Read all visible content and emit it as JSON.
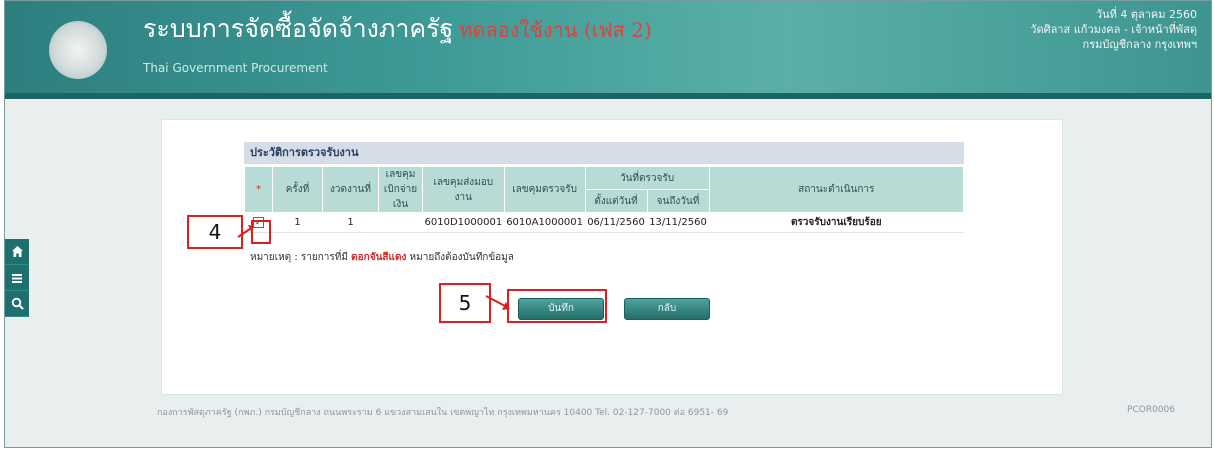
{
  "header": {
    "title": "ระบบการจัดซื้อจัดจ้างภาครัฐ",
    "title_highlight": "ทดลองใช้งาน (เฟส 2)",
    "subtitle": "Thai Government Procurement",
    "date": "วันที่ 4 ตุลาคม 2560",
    "user": "วัดศิลาส แก้วมงคล - เจ้าหน้าที่พัสดุ",
    "org": "กรมบัญชีกลาง กรุงเทพฯ"
  },
  "sidebar": {
    "items": [
      "home-icon",
      "menu-icon",
      "search-icon"
    ]
  },
  "history": {
    "title": "ประวัติการตรวจรับงาน",
    "headers": {
      "select": "*",
      "round": "ครั้งที่",
      "period": "งวดงานที่",
      "disbursement": "เลขคุมเบิกจ่ายเงิน",
      "delivery": "เลขคุมส่งมอบงาน",
      "inspection": "เลขคุมตรวจรับ",
      "inspect_date": "วันที่ตรวจรับ",
      "from_date": "ตั้งแต่วันที่",
      "to_date": "จนถึงวันที่",
      "status": "สถานะดำเนินการ"
    },
    "rows": [
      {
        "checked": "✓",
        "round": "1",
        "period": "1",
        "disbursement": "",
        "delivery": "6010D1000001",
        "inspection": "6010A1000001",
        "from_date": "06/11/2560",
        "to_date": "13/11/2560",
        "status": "ตรวจรับงานเรียบร้อย"
      }
    ],
    "note_prefix": "หมายเหตุ : รายการที่มี",
    "note_red": "ดอกจันสีแดง",
    "note_suffix": "หมายถึงต้องบันทึกข้อมูล"
  },
  "buttons": {
    "save": "บันทึก",
    "back": "กลับ"
  },
  "footer": {
    "text": "กองการพัสดุภาครัฐ (กพภ.) กรมบัญชีกลาง ถนนพระราม 6 แขวงสามเสนใน เขตพญาไท กรุงเทพมหานคร 10400 Tel. 02-127-7000 ต่อ 6951- 69",
    "code": "PCOR0006"
  },
  "annotations": {
    "step4": "4",
    "step5": "5"
  },
  "colors": {
    "header": "#3e9a96",
    "accent": "#226e69",
    "annotation": "#e21d1d"
  }
}
